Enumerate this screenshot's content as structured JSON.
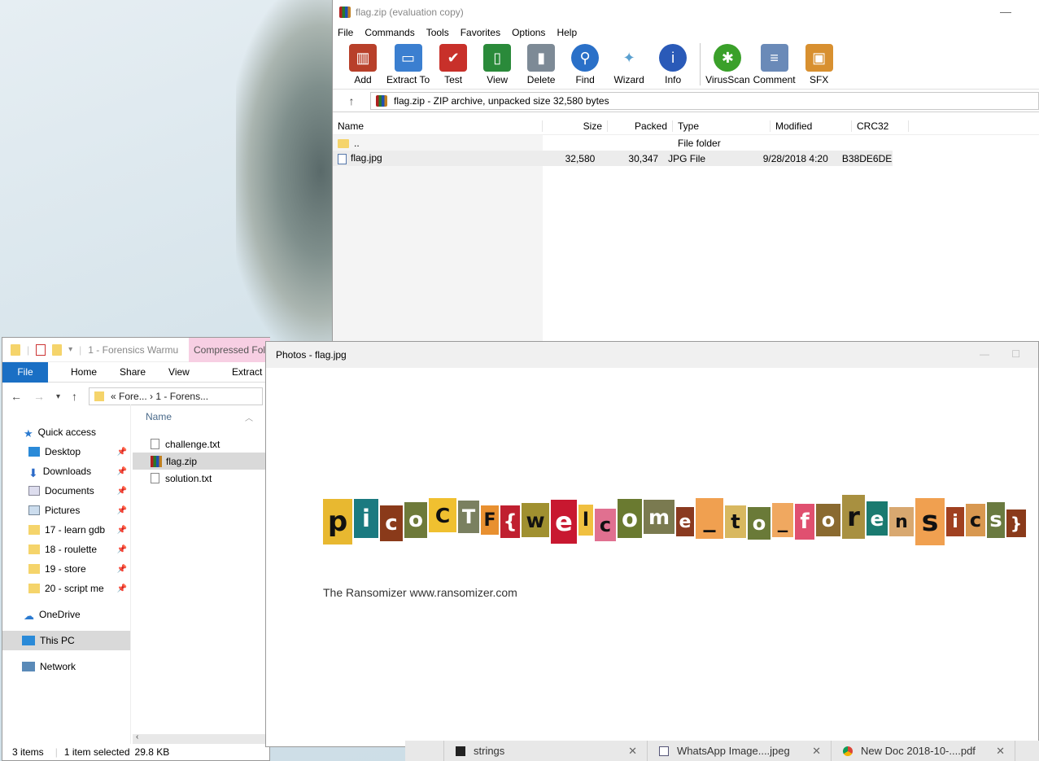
{
  "winrar": {
    "title": "flag.zip (evaluation copy)",
    "minimize": "—",
    "menu": [
      "File",
      "Commands",
      "Tools",
      "Favorites",
      "Options",
      "Help"
    ],
    "toolbar": [
      {
        "label": "Add",
        "icon": "add-books-icon",
        "color": "#b8402a"
      },
      {
        "label": "Extract To",
        "icon": "extract-folder-icon",
        "color": "#3b7fd0"
      },
      {
        "label": "Test",
        "icon": "test-clipboard-icon",
        "color": "#c8302a"
      },
      {
        "label": "View",
        "icon": "view-book-icon",
        "color": "#2a8a3a"
      },
      {
        "label": "Delete",
        "icon": "trash-icon",
        "color": "#7d8a96"
      },
      {
        "label": "Find",
        "icon": "magnifier-icon",
        "color": "#2a70c8"
      },
      {
        "label": "Wizard",
        "icon": "wand-icon",
        "color": "#5aa0d0"
      },
      {
        "label": "Info",
        "icon": "info-icon",
        "color": "#2a5ab8"
      },
      {
        "label": "VirusScan",
        "icon": "bug-icon",
        "color": "#3aa02a"
      },
      {
        "label": "Comment",
        "icon": "comment-icon",
        "color": "#6a8ab8"
      },
      {
        "label": "SFX",
        "icon": "sfx-box-icon",
        "color": "#d89030"
      }
    ],
    "address": "flag.zip - ZIP archive, unpacked size 32,580 bytes",
    "columns": {
      "name": "Name",
      "size": "Size",
      "packed": "Packed",
      "type": "Type",
      "modified": "Modified",
      "crc": "CRC32"
    },
    "rows": [
      {
        "name": "..",
        "size": "",
        "packed": "",
        "type": "File folder",
        "modified": "",
        "crc": ""
      },
      {
        "name": "flag.jpg",
        "size": "32,580",
        "packed": "30,347",
        "type": "JPG File",
        "modified": "9/28/2018 4:20",
        "crc": "B38DE6DE"
      }
    ]
  },
  "explorer": {
    "qat_title": "1 - Forensics Warmu",
    "context_tab": "Compressed Folde",
    "tabs": {
      "file": "File",
      "home": "Home",
      "share": "Share",
      "view": "View",
      "extract": "Extract"
    },
    "path": "«  Fore...  ›  1 - Forens...",
    "nav": [
      {
        "label": "Quick access",
        "icon": "star-icon",
        "pinned": false
      },
      {
        "label": "Desktop",
        "icon": "desktop-icon",
        "pinned": true
      },
      {
        "label": "Downloads",
        "icon": "download-icon",
        "pinned": true
      },
      {
        "label": "Documents",
        "icon": "documents-icon",
        "pinned": true
      },
      {
        "label": "Pictures",
        "icon": "pictures-icon",
        "pinned": true
      },
      {
        "label": "17 - learn gdb",
        "icon": "folder-icon",
        "pinned": true
      },
      {
        "label": "18 - roulette",
        "icon": "folder-icon",
        "pinned": true
      },
      {
        "label": "19 - store",
        "icon": "folder-icon",
        "pinned": true
      },
      {
        "label": "20 - script me",
        "icon": "folder-icon",
        "pinned": true
      },
      {
        "label": "OneDrive",
        "icon": "cloud-icon",
        "pinned": false
      },
      {
        "label": "This PC",
        "icon": "computer-icon",
        "pinned": false
      },
      {
        "label": "Network",
        "icon": "network-icon",
        "pinned": false
      }
    ],
    "column_name": "Name",
    "files": [
      {
        "name": "challenge.txt",
        "type": "txt"
      },
      {
        "name": "flag.zip",
        "type": "zip"
      },
      {
        "name": "solution.txt",
        "type": "txt"
      }
    ],
    "status": {
      "items": "3 items",
      "selected": "1 item selected",
      "size": "29.8 KB"
    }
  },
  "photos": {
    "title": "Photos - flag.jpg",
    "ransom_letters": [
      {
        "ch": "p",
        "bg": "#e8b830",
        "fg": "#111"
      },
      {
        "ch": "i",
        "bg": "#1b7a80",
        "fg": "#fff"
      },
      {
        "ch": "c",
        "bg": "#8a3a1a",
        "fg": "#fff"
      },
      {
        "ch": "o",
        "bg": "#6e7a3a",
        "fg": "#fff"
      },
      {
        "ch": "C",
        "bg": "#f0c030",
        "fg": "#111"
      },
      {
        "ch": "T",
        "bg": "#7a8060",
        "fg": "#fff"
      },
      {
        "ch": "F",
        "bg": "#e89030",
        "fg": "#111"
      },
      {
        "ch": "{",
        "bg": "#c02030",
        "fg": "#fff"
      },
      {
        "ch": "w",
        "bg": "#a09030",
        "fg": "#111"
      },
      {
        "ch": "e",
        "bg": "#c81830",
        "fg": "#fff"
      },
      {
        "ch": "l",
        "bg": "#f0c040",
        "fg": "#111"
      },
      {
        "ch": "c",
        "bg": "#e07090",
        "fg": "#111"
      },
      {
        "ch": "o",
        "bg": "#6a7a30",
        "fg": "#fff"
      },
      {
        "ch": "m",
        "bg": "#7a7a50",
        "fg": "#fff"
      },
      {
        "ch": "e",
        "bg": "#8a3a20",
        "fg": "#fff"
      },
      {
        "ch": "_",
        "bg": "#f0a050",
        "fg": "#111"
      },
      {
        "ch": "t",
        "bg": "#d8b860",
        "fg": "#111"
      },
      {
        "ch": "o",
        "bg": "#6a7a38",
        "fg": "#fff"
      },
      {
        "ch": "_",
        "bg": "#f0a860",
        "fg": "#111"
      },
      {
        "ch": "f",
        "bg": "#e05070",
        "fg": "#fff"
      },
      {
        "ch": "o",
        "bg": "#8a6a30",
        "fg": "#fff"
      },
      {
        "ch": "r",
        "bg": "#a89040",
        "fg": "#111"
      },
      {
        "ch": "e",
        "bg": "#1a7a70",
        "fg": "#fff"
      },
      {
        "ch": "n",
        "bg": "#d8a870",
        "fg": "#111"
      },
      {
        "ch": "s",
        "bg": "#f0a050",
        "fg": "#111"
      },
      {
        "ch": "i",
        "bg": "#a04020",
        "fg": "#fff"
      },
      {
        "ch": "c",
        "bg": "#d89850",
        "fg": "#111"
      },
      {
        "ch": "s",
        "bg": "#6a7a40",
        "fg": "#fff"
      },
      {
        "ch": "}",
        "bg": "#8a3a1a",
        "fg": "#fff"
      }
    ],
    "credit": "The Ransomizer www.ransomizer.com"
  },
  "taskbar": [
    {
      "label": "strings",
      "icon": "terminal-icon"
    },
    {
      "label": "WhatsApp Image....jpeg",
      "icon": "image-icon"
    },
    {
      "label": "New Doc 2018-10-....pdf",
      "icon": "chrome-icon"
    }
  ]
}
